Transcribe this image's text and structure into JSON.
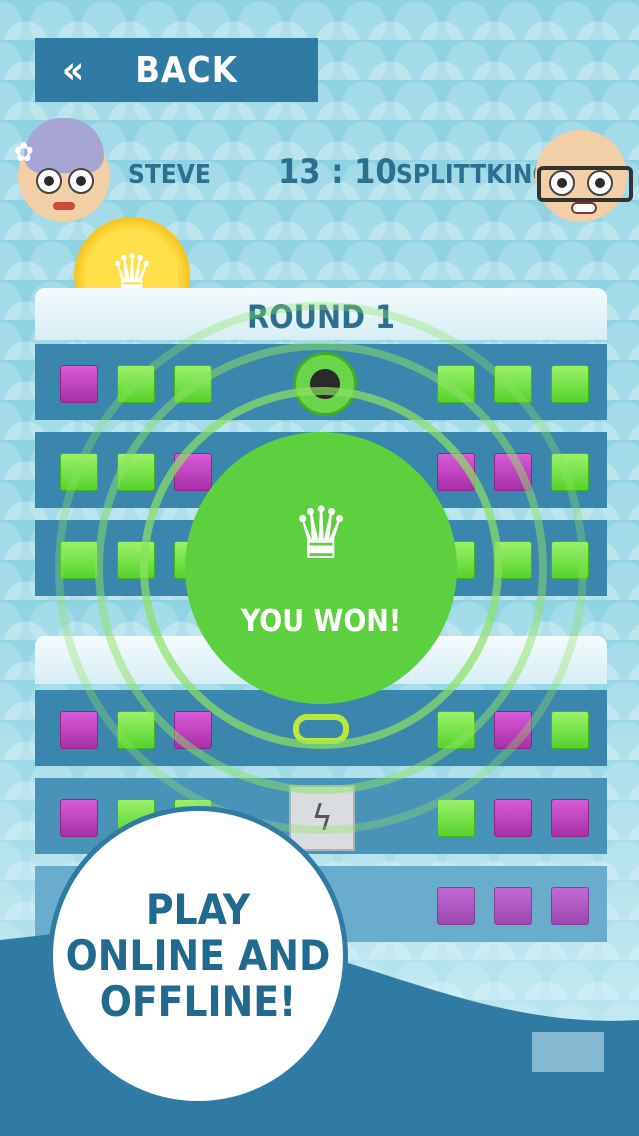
{
  "header": {
    "back_label": "BACK",
    "back_icon": "double-chevron-left-icon"
  },
  "players": {
    "left": {
      "name": "STEVE",
      "avatar": "grandma-avatar"
    },
    "right": {
      "name": "SPLITTKING",
      "avatar": "bald-glasses-avatar"
    }
  },
  "timer": "13 : 10",
  "badge": {
    "icon": "crown-icon"
  },
  "round": {
    "title": "ROUND 1"
  },
  "result": {
    "icon": "crown-icon",
    "text": "YOU WON!"
  },
  "powerups": {
    "bomb": "bomb-icon",
    "link": "chain-link-icon",
    "lightning": "lightning-icon"
  },
  "promo": {
    "line1": "PLAY",
    "line2": "ONLINE AND",
    "line3": "OFFLINE!"
  },
  "colors": {
    "green": "#5cd03e",
    "magenta": "#c043c0",
    "blue": "#2f7ba3",
    "background": "#8fd3e3"
  }
}
